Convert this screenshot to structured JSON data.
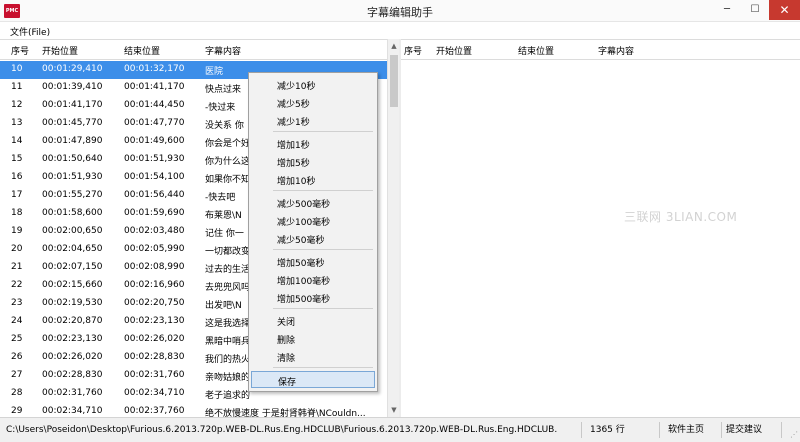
{
  "window": {
    "title": "字幕编辑助手",
    "icon_text": "PMC",
    "buttons": {
      "minimize": "─",
      "maximize": "☐",
      "close": "✕"
    }
  },
  "menu": {
    "file": "文件(File)"
  },
  "columns": {
    "num": "序号",
    "start": "开始位置",
    "end": "结束位置",
    "text": "字幕内容"
  },
  "rows": [
    {
      "num": "10",
      "start": "00:01:29,410",
      "end": "00:01:32,170",
      "text": "医院",
      "selected": true
    },
    {
      "num": "11",
      "start": "00:01:39,410",
      "end": "00:01:41,170",
      "text": "快点过来"
    },
    {
      "num": "12",
      "start": "00:01:41,170",
      "end": "00:01:44,450",
      "text": "-快过来"
    },
    {
      "num": "13",
      "start": "00:01:45,770",
      "end": "00:01:47,770",
      "text": "没关系 你"
    },
    {
      "num": "14",
      "start": "00:01:47,890",
      "end": "00:01:49,600",
      "text": "你会是个好"
    },
    {
      "num": "15",
      "start": "00:01:50,640",
      "end": "00:01:51,930",
      "text": "你为什么这"
    },
    {
      "num": "16",
      "start": "00:01:51,930",
      "end": "00:01:54,100",
      "text": "如果你不知"
    },
    {
      "num": "17",
      "start": "00:01:55,270",
      "end": "00:01:56,440",
      "text": "-快去吧"
    },
    {
      "num": "18",
      "start": "00:01:58,600",
      "end": "00:01:59,690",
      "text": "布莱恩\\N"
    },
    {
      "num": "19",
      "start": "00:02:00,650",
      "end": "00:02:03,480",
      "text": "记住 你一"
    },
    {
      "num": "20",
      "start": "00:02:04,650",
      "end": "00:02:05,990",
      "text": "一切都改变"
    },
    {
      "num": "21",
      "start": "00:02:07,150",
      "end": "00:02:08,990",
      "text": "过去的生活"
    },
    {
      "num": "22",
      "start": "00:02:15,660",
      "end": "00:02:16,960",
      "text": "去兜兜风吗"
    },
    {
      "num": "23",
      "start": "00:02:19,530",
      "end": "00:02:20,750",
      "text": "出发吧\\N"
    },
    {
      "num": "24",
      "start": "00:02:20,870",
      "end": "00:02:23,130",
      "text": "这是我选择"
    },
    {
      "num": "25",
      "start": "00:02:23,130",
      "end": "00:02:26,020",
      "text": "黑暗中哨兵"
    },
    {
      "num": "26",
      "start": "00:02:26,020",
      "end": "00:02:28,830",
      "text": "我们的热火"
    },
    {
      "num": "27",
      "start": "00:02:28,830",
      "end": "00:02:31,760",
      "text": "亲吻姑娘的"
    },
    {
      "num": "28",
      "start": "00:02:31,760",
      "end": "00:02:34,710",
      "text": "老子追求的"
    },
    {
      "num": "29",
      "start": "00:02:34,710",
      "end": "00:02:37,760",
      "text": "绝不放慢速度 于是射肾韩脊\\NCouldn..."
    },
    {
      "num": "30",
      "start": "00:02:37,760",
      "end": "00:02:40,620",
      "text": "你用吸管 老子用美金\\NYou used pla..."
    }
  ],
  "context_menu": [
    {
      "label": "减少10秒"
    },
    {
      "label": "减少5秒"
    },
    {
      "label": "减少1秒"
    },
    {
      "label": "增加1秒"
    },
    {
      "label": "增加5秒"
    },
    {
      "label": "增加10秒"
    },
    {
      "label": "减少500毫秒"
    },
    {
      "label": "减少100毫秒"
    },
    {
      "label": "减少50毫秒"
    },
    {
      "label": "增加50毫秒"
    },
    {
      "label": "增加100毫秒"
    },
    {
      "label": "增加500毫秒"
    },
    {
      "label": "关闭"
    },
    {
      "label": "删除"
    },
    {
      "label": "清除"
    },
    {
      "label": "保存",
      "highlighted": true
    }
  ],
  "status": {
    "path": "C:\\Users\\Poseidon\\Desktop\\Furious.6.2013.720p.WEB-DL.Rus.Eng.HDCLUB\\Furious.6.2013.720p.WEB-DL.Rus.Eng.HDCLUB.",
    "lines": "1365 行",
    "home": "软件主页",
    "suggest": "提交建议"
  },
  "watermark": "三联网 3LIAN.COM",
  "colors": {
    "selection": "#3c8ee9",
    "close_button": "#c7392f",
    "app_icon": "#c8102e",
    "menu_highlight": "#dbe8f6"
  }
}
